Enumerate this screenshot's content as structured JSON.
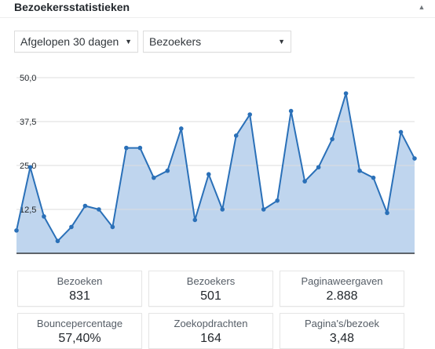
{
  "widget": {
    "title": "Bezoekersstatistieken",
    "collapse_icon": "triangle-up-icon"
  },
  "filters": {
    "range": "Afgelopen 30 dagen",
    "metric": "Bezoekers",
    "dropdown_icon": "triangle-down-icon"
  },
  "colors": {
    "line": "#2a70b8",
    "fill": "#bfd5ee",
    "grid": "#dddddd",
    "baseline": "#32373c"
  },
  "chart_data": {
    "type": "area",
    "title": "",
    "xlabel": "",
    "ylabel": "",
    "ylim": [
      0,
      50
    ],
    "yticks": [
      "12,5",
      "25,0",
      "37,5",
      "50,0"
    ],
    "ytick_values": [
      12.5,
      25.0,
      37.5,
      50.0
    ],
    "grid": true,
    "series": [
      {
        "values": [
          6.5,
          24.5,
          10.5,
          3.5,
          7.5,
          13.5,
          12.5,
          7.5,
          30,
          30,
          21.5,
          23.5,
          35.5,
          9.5,
          22.5,
          12.5,
          33.5,
          39.5,
          12.5,
          15,
          40.5,
          20.5,
          24.5,
          32.5,
          45.5,
          23.5,
          21.5,
          11.5,
          34.5,
          27
        ]
      }
    ]
  },
  "stats": [
    {
      "label": "Bezoeken",
      "value": "831"
    },
    {
      "label": "Bezoekers",
      "value": "501"
    },
    {
      "label": "Paginaweergaven",
      "value": "2.888"
    },
    {
      "label": "Bouncepercentage",
      "value": "57,40%"
    },
    {
      "label": "Zoekopdrachten",
      "value": "164"
    },
    {
      "label": "Pagina's/bezoek",
      "value": "3,48"
    }
  ]
}
